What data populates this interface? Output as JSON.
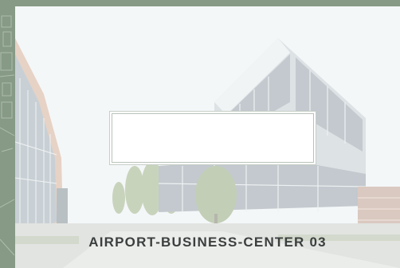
{
  "card": {
    "title": "AIRPORT-BUSINESS-CENTER 03",
    "image": "office-building-photo"
  },
  "colors": {
    "frame": "#869a86",
    "caption": "#3b3f3e",
    "label_box": "#ffffff"
  }
}
